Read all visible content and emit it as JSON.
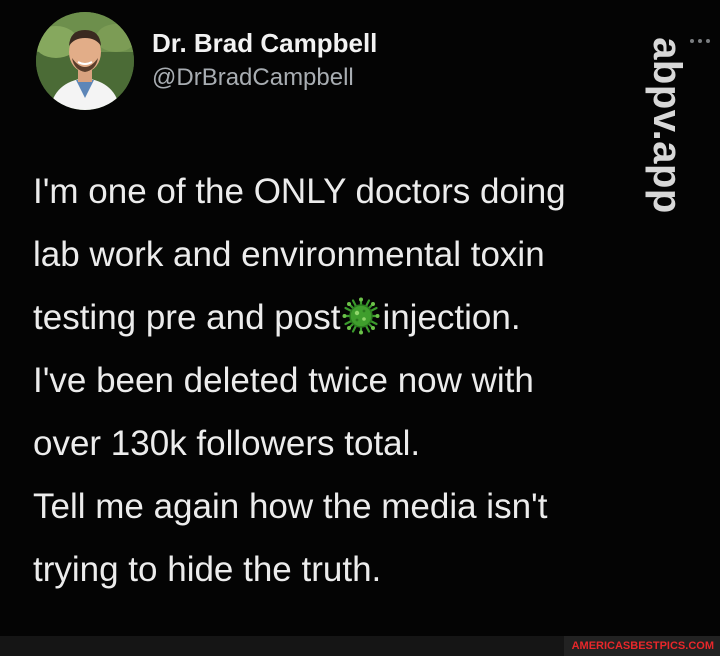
{
  "tweet": {
    "display_name": "Dr. Brad Campbell",
    "handle": "@DrBradCampbell",
    "lines": {
      "l1": "I'm one of the ONLY doctors doing",
      "l2": "lab work and environmental toxin",
      "l3a": "testing pre and post",
      "l3b": "injection.",
      "l4": "I've been deleted twice now with",
      "l5": "over 130k followers total.",
      "l6": "Tell me again how the media isn't",
      "l7": "trying to hide the truth."
    },
    "inline_icon": "virus-emoji-icon"
  },
  "watermark": {
    "text": "abpv.app"
  },
  "footer": {
    "site_text": "AMERICASBESTPICS.COM"
  },
  "colors": {
    "background": "#000000",
    "text": "#ececec",
    "handle": "#a8adb2",
    "virus": "#3a9a2c",
    "site_text": "#e8272a"
  }
}
